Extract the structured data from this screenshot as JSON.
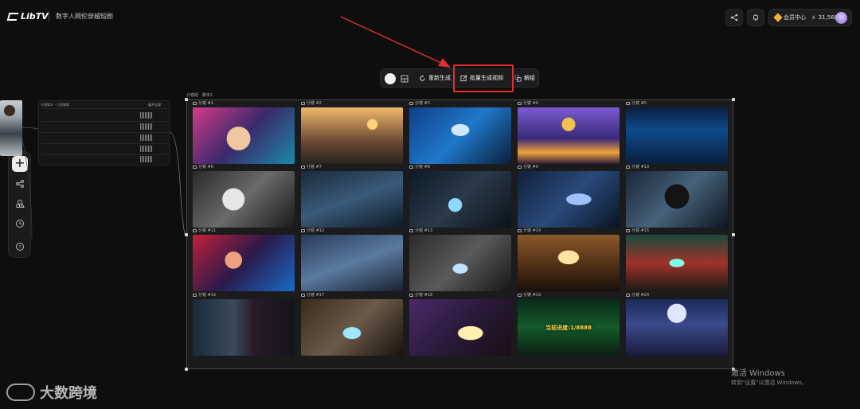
{
  "app": {
    "logo_text": "LibTV",
    "project_title": "数字人网伦穿越短剧"
  },
  "header": {
    "member_label": "会员中心",
    "credits": "31,568"
  },
  "toolbar": {
    "regenerate_label": "重新生成",
    "batch_video_label": "批量生成视频",
    "ungroup_label": "解组"
  },
  "left_node": {
    "table_title": "分镜脚本 - 可视编辑",
    "table_action": "展开全部"
  },
  "storyboard": {
    "group_label": "分镜组 · 脚本2",
    "progress_text": "当前进度:1/8888",
    "cells": [
      {
        "label": "分镜 #1"
      },
      {
        "label": "分镜 #2"
      },
      {
        "label": "分镜 #3"
      },
      {
        "label": "分镜 #4"
      },
      {
        "label": "分镜 #5"
      },
      {
        "label": "分镜 #6"
      },
      {
        "label": "分镜 #7"
      },
      {
        "label": "分镜 #8"
      },
      {
        "label": "分镜 #9"
      },
      {
        "label": "分镜 #10"
      },
      {
        "label": "分镜 #11"
      },
      {
        "label": "分镜 #12"
      },
      {
        "label": "分镜 #13"
      },
      {
        "label": "分镜 #14"
      },
      {
        "label": "分镜 #15"
      },
      {
        "label": "分镜 #16"
      },
      {
        "label": "分镜 #17"
      },
      {
        "label": "分镜 #18"
      },
      {
        "label": "分镜 #19"
      },
      {
        "label": "分镜 #20"
      }
    ]
  },
  "watermark": {
    "text": "大数跨境"
  },
  "os_notice": {
    "title": "激活 Windows",
    "subtitle": "转到\"设置\"以激活 Windows。"
  },
  "colors": {
    "accent_red": "#e0302f",
    "gold": "#f3b13b"
  }
}
